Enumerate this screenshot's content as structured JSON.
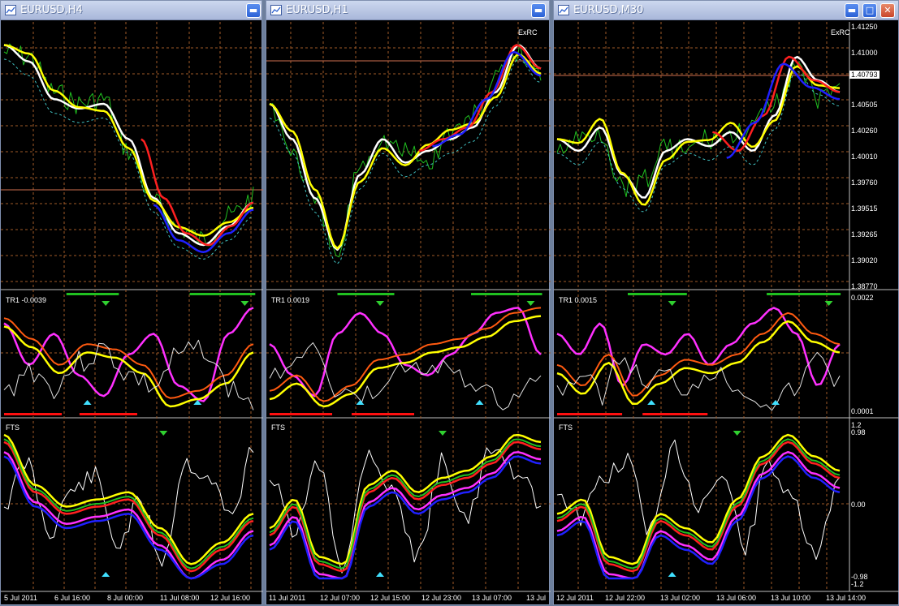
{
  "windows": [
    {
      "title": "EURUSD,H4",
      "buttons": [
        "restore"
      ],
      "price_axis": [],
      "indicator1_label": "TR1 -0.0039",
      "indicator1_scale": [],
      "indicator2_label": "FTS",
      "indicator2_scale": [],
      "time_axis": [
        "5 Jul 2011",
        "6 Jul 16:00",
        "8 Jul 00:00",
        "11 Jul 08:00",
        "12 Jul 16:00"
      ],
      "badge": ""
    },
    {
      "title": "EURUSD,H1",
      "buttons": [
        "restore"
      ],
      "price_axis": [],
      "indicator1_label": "TR1 0.0019",
      "indicator1_scale": [],
      "indicator2_label": "FTS",
      "indicator2_scale": [],
      "time_axis": [
        "11 Jul 2011",
        "12 Jul 07:00",
        "12 Jul 15:00",
        "12 Jul 23:00",
        "13 Jul 07:00",
        "13 Jul"
      ],
      "badge": "ExRC"
    },
    {
      "title": "EURUSD,M30",
      "buttons": [
        "minimize",
        "maximize",
        "close"
      ],
      "price_axis": [
        "1.41250",
        "1.41000",
        "1.40793",
        "1.40505",
        "1.40260",
        "1.40010",
        "1.39760",
        "1.39515",
        "1.39265",
        "1.39020",
        "1.38770"
      ],
      "current_price": "1.40793",
      "indicator1_label": "TR1 0.0015",
      "indicator1_scale": [
        "0.0022",
        "0.0001"
      ],
      "indicator2_label": "FTS",
      "indicator2_scale": [
        "1.2",
        "0.98",
        "0.00",
        "-0.98",
        "-1.2"
      ],
      "time_axis": [
        "12 Jul 2011",
        "12 Jul 22:00",
        "13 Jul 02:00",
        "13 Jul 06:00",
        "13 Jul 10:00",
        "13 Jul 14:00"
      ],
      "badge": "ExRC"
    }
  ],
  "icons": {
    "restore": "restore-icon",
    "minimize": "minimize-icon",
    "maximize": "maximize-icon",
    "close": "close-icon",
    "app": "chart-window-icon"
  },
  "colors": {
    "background": "#000000",
    "grid": "#a05a28",
    "bullish": "#ff2020",
    "bearish": "#ffff00",
    "trend": "#ffffff",
    "trend_up": "#2020ff",
    "candles": "#20c020",
    "osc_magenta": "#ff30ff",
    "osc_orange": "#ff5a10",
    "signal_bar": "#20c020",
    "signal_red": "#ff1010",
    "up_arrow": "#40e0ff",
    "down_arrow": "#30d030"
  }
}
